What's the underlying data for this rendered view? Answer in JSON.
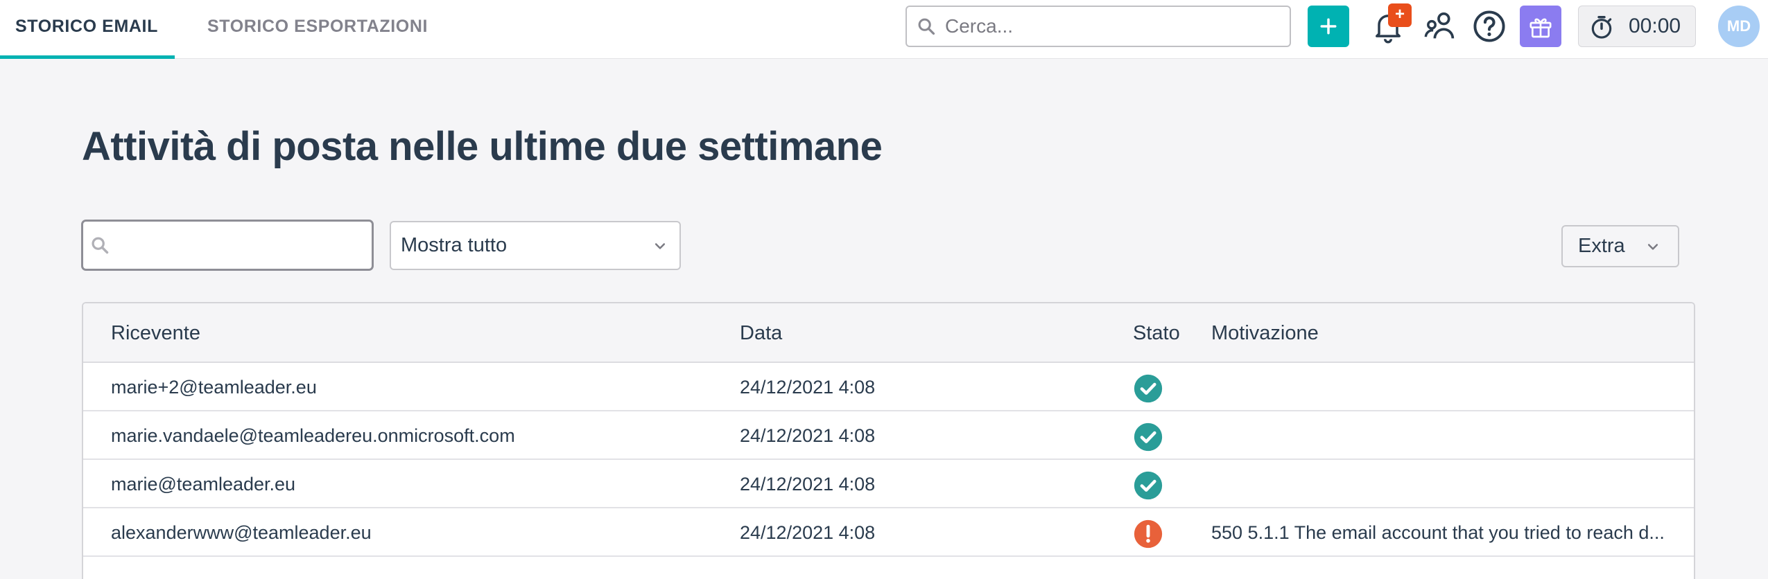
{
  "tabs": [
    {
      "label": "STORICO EMAIL",
      "active": true
    },
    {
      "label": "STORICO ESPORTAZIONI",
      "active": false
    }
  ],
  "header": {
    "search_placeholder": "Cerca...",
    "add_label": "+",
    "notification_badge": "+",
    "timer": "00:00",
    "avatar_initials": "MD"
  },
  "main": {
    "title": "Attività di posta nelle ultime due settimane",
    "filter_search_value": "",
    "select_value": "Mostra tutto",
    "extra_label": "Extra"
  },
  "table": {
    "columns": [
      "Ricevente",
      "Data",
      "Stato",
      "Motivazione"
    ],
    "rows": [
      {
        "recipient": "marie+2@teamleader.eu",
        "date": "24/12/2021 4:08",
        "status": "success",
        "reason": ""
      },
      {
        "recipient": "marie.vandaele@teamleadereu.onmicrosoft.com",
        "date": "24/12/2021 4:08",
        "status": "success",
        "reason": ""
      },
      {
        "recipient": "marie@teamleader.eu",
        "date": "24/12/2021 4:08",
        "status": "success",
        "reason": ""
      },
      {
        "recipient": "alexanderwww@teamleader.eu",
        "date": "24/12/2021 4:08",
        "status": "error",
        "reason": "550 5.1.1 The email account that you tried to reach d..."
      }
    ]
  },
  "colors": {
    "accent": "#00b2b2",
    "success": "#2a9d98",
    "error": "#e8613a",
    "badge": "#e94e1b",
    "gift": "#8b7cf0",
    "avatar": "#a8cdf5",
    "text": "#2a3b4d"
  },
  "icons": {
    "search": "search-icon",
    "bell": "bell-icon",
    "users": "users-icon",
    "help": "help-icon",
    "gift": "gift-icon",
    "timer": "stopwatch-icon",
    "chevron": "chevron-down-icon",
    "success": "check-circle-icon",
    "error": "exclamation-circle-icon"
  }
}
